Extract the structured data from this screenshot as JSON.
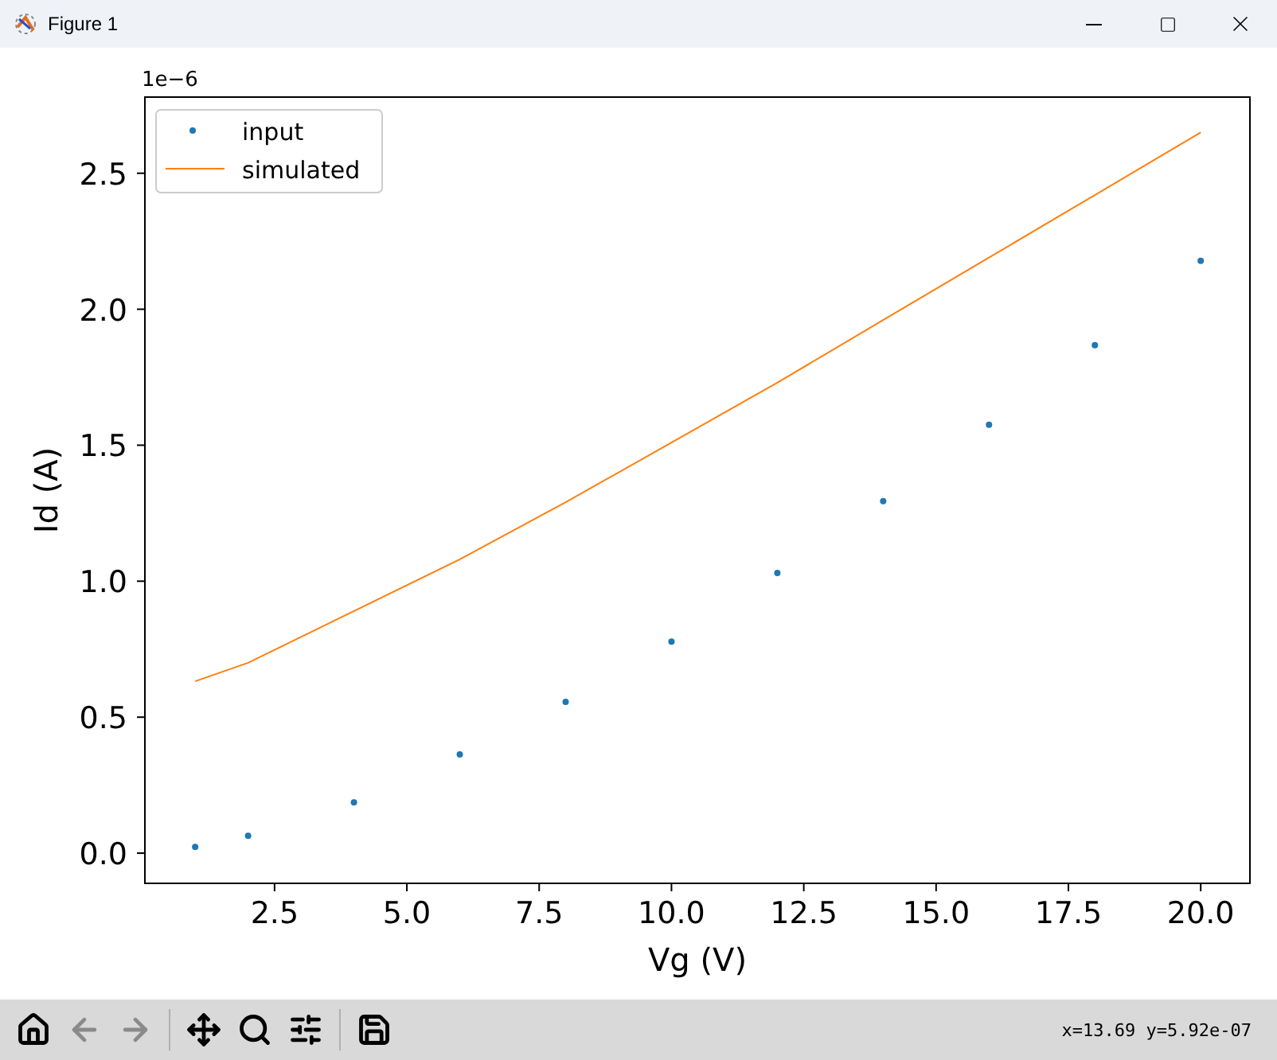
{
  "window": {
    "title": "Figure 1"
  },
  "chart_data": {
    "type": "line",
    "xlabel": "Vg (V)",
    "ylabel": "Id (A)",
    "annotations": [
      {
        "text": "1e−6"
      }
    ],
    "legend": true,
    "x": [
      1,
      2,
      4,
      6,
      8,
      10,
      12,
      14,
      16,
      18,
      20
    ],
    "series": [
      {
        "name": "input",
        "color": "#1f77b4",
        "type": "scatter",
        "values": [
          0.023,
          0.064,
          0.187,
          0.363,
          0.556,
          0.778,
          1.03,
          1.294,
          1.575,
          1.868,
          2.178
        ]
      },
      {
        "name": "simulated",
        "color": "#ff7f0e",
        "type": "line",
        "values": [
          0.632,
          0.7,
          0.89,
          1.08,
          1.29,
          1.51,
          1.73,
          1.96,
          2.19,
          2.42,
          2.65
        ]
      }
    ],
    "xlim": [
      0.05,
      20.93
    ],
    "ylim": [
      -0.111,
      2.78
    ],
    "xticks": [
      {
        "value": 2.5,
        "label": "2.5"
      },
      {
        "value": 5,
        "label": "5.0"
      },
      {
        "value": 7.5,
        "label": "7.5"
      },
      {
        "value": 10,
        "label": "10.0"
      },
      {
        "value": 12.5,
        "label": "12.5"
      },
      {
        "value": 15,
        "label": "15.0"
      },
      {
        "value": 17.5,
        "label": "17.5"
      },
      {
        "value": 20,
        "label": "20.0"
      }
    ],
    "yticks": [
      {
        "value": 0,
        "label": "0.0"
      },
      {
        "value": 0.5,
        "label": "0.5"
      },
      {
        "value": 1,
        "label": "1.0"
      },
      {
        "value": 1.5,
        "label": "1.5"
      },
      {
        "value": 2,
        "label": "2.0"
      },
      {
        "value": 2.5,
        "label": "2.5"
      }
    ]
  },
  "toolbar": [
    {
      "kind": "home",
      "disabled": false
    },
    {
      "kind": "back",
      "disabled": true
    },
    {
      "kind": "forward",
      "disabled": true
    },
    {
      "kind": "sep"
    },
    {
      "kind": "pan",
      "disabled": false
    },
    {
      "kind": "zoom",
      "disabled": false
    },
    {
      "kind": "configure",
      "disabled": false
    },
    {
      "kind": "sep"
    },
    {
      "kind": "save",
      "disabled": false
    }
  ],
  "status": "x=13.69 y=5.92e-07"
}
